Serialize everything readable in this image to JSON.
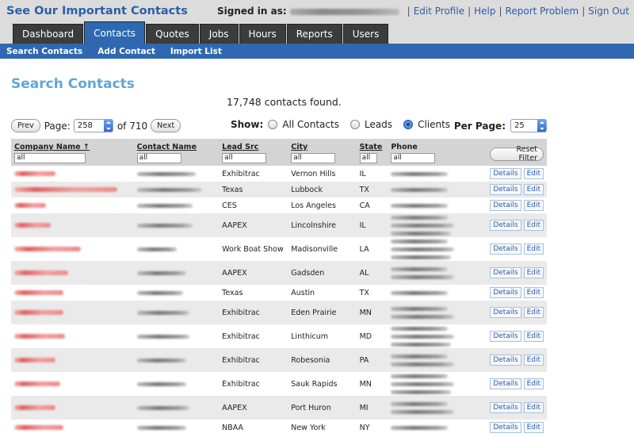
{
  "header": {
    "title": "See Our Important Contacts",
    "signed_in_label": "Signed in as:",
    "links": [
      "Edit Profile",
      "Help",
      "Report Problem",
      "Sign Out"
    ]
  },
  "tabs": [
    {
      "label": "Dashboard",
      "active": false
    },
    {
      "label": "Contacts",
      "active": true
    },
    {
      "label": "Quotes",
      "active": false
    },
    {
      "label": "Jobs",
      "active": false
    },
    {
      "label": "Hours",
      "active": false
    },
    {
      "label": "Reports",
      "active": false
    },
    {
      "label": "Users",
      "active": false
    }
  ],
  "subnav": [
    "Search Contacts",
    "Add Contact",
    "Import List"
  ],
  "page": {
    "title": "Search Contacts",
    "found": "17,748 contacts found."
  },
  "pager": {
    "prev": "Prev",
    "page_label": "Page:",
    "page_value": "258",
    "of_text": "of 710",
    "next": "Next"
  },
  "show": {
    "label": "Show:",
    "options": [
      {
        "label": "All Contacts",
        "selected": false
      },
      {
        "label": "Leads",
        "selected": false
      },
      {
        "label": "Clients",
        "selected": true
      }
    ]
  },
  "per_page": {
    "label": "Per Page:",
    "value": "25"
  },
  "table": {
    "columns": [
      {
        "label": "Company Name ↑",
        "filter": "all"
      },
      {
        "label": "Contact Name",
        "filter": "all"
      },
      {
        "label": "Lead Src",
        "filter": "all"
      },
      {
        "label": "City",
        "filter": "all"
      },
      {
        "label": "State",
        "filter": "all"
      },
      {
        "label": "Phone",
        "filter": "all"
      }
    ],
    "reset_filter": "Reset Filter",
    "details_label": "Details",
    "edit_label": "Edit",
    "rows": [
      {
        "lead": "Exhibitrac",
        "city": "Vernon Hills",
        "state": "IL",
        "phones": 1
      },
      {
        "lead": "Texas",
        "city": "Lubbock",
        "state": "TX",
        "phones": 1
      },
      {
        "lead": "CES",
        "city": "Los Angeles",
        "state": "CA",
        "phones": 1
      },
      {
        "lead": "AAPEX",
        "city": "Lincolnshire",
        "state": "IL",
        "phones": 3
      },
      {
        "lead": "Work Boat Show",
        "city": "Madisonville",
        "state": "LA",
        "phones": 3
      },
      {
        "lead": "AAPEX",
        "city": "Gadsden",
        "state": "AL",
        "phones": 2
      },
      {
        "lead": "Texas",
        "city": "Austin",
        "state": "TX",
        "phones": 1
      },
      {
        "lead": "Exhibitrac",
        "city": "Eden Prairie",
        "state": "MN",
        "phones": 2
      },
      {
        "lead": "Exhibitrac",
        "city": "Linthicum",
        "state": "MD",
        "phones": 3
      },
      {
        "lead": "Exhibitrac",
        "city": "Robesonia",
        "state": "PA",
        "phones": 2
      },
      {
        "lead": "Exhibitrac",
        "city": "Sauk Rapids",
        "state": "MN",
        "phones": 3
      },
      {
        "lead": "AAPEX",
        "city": "Port Huron",
        "state": "MI",
        "phones": 2
      },
      {
        "lead": "NBAA",
        "city": "New York",
        "state": "NY",
        "phones": 1
      }
    ]
  }
}
